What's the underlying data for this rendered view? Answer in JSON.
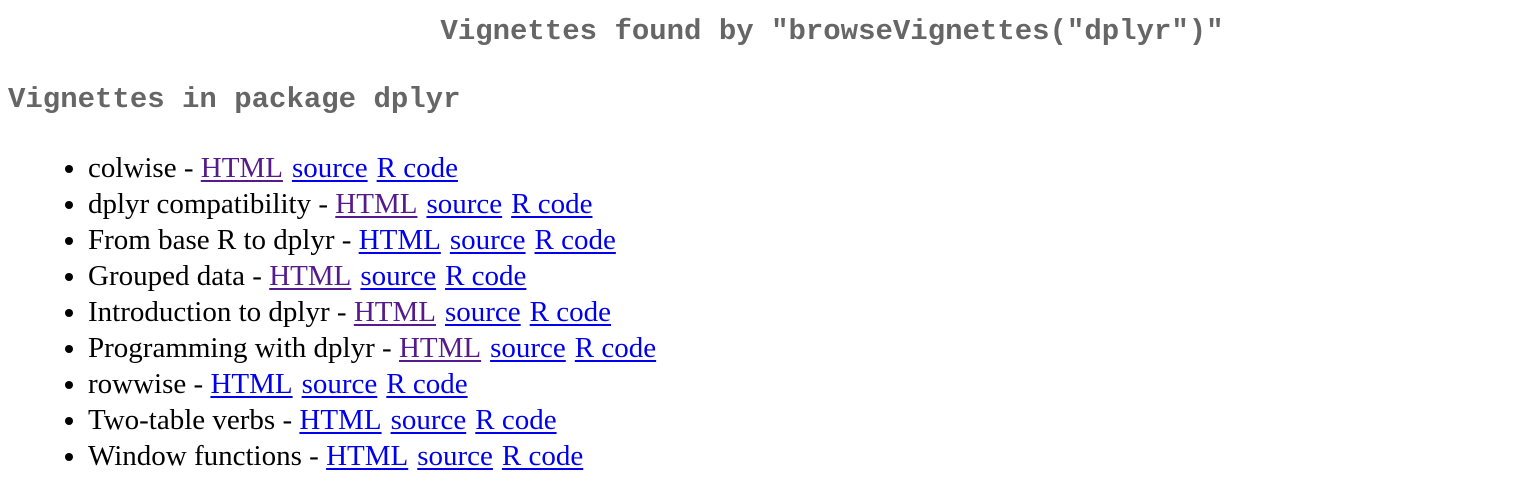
{
  "page": {
    "title": "Vignettes found by \"browseVignettes(\"dplyr\")\"",
    "section_heading": "Vignettes in package dplyr",
    "separator": " - "
  },
  "colors": {
    "heading": "#666666",
    "link": "#0000ee",
    "visited_link": "#551a8b"
  },
  "vignettes": [
    {
      "name": "colwise",
      "html": "HTML",
      "source": "source",
      "rcode": "R code",
      "html_visited": true
    },
    {
      "name": "dplyr compatibility",
      "html": "HTML",
      "source": "source",
      "rcode": "R code",
      "html_visited": true
    },
    {
      "name": "From base R to dplyr",
      "html": "HTML",
      "source": "source",
      "rcode": "R code",
      "html_visited": false
    },
    {
      "name": "Grouped data",
      "html": "HTML",
      "source": "source",
      "rcode": "R code",
      "html_visited": true
    },
    {
      "name": "Introduction to dplyr",
      "html": "HTML",
      "source": "source",
      "rcode": "R code",
      "html_visited": true
    },
    {
      "name": "Programming with dplyr",
      "html": "HTML",
      "source": "source",
      "rcode": "R code",
      "html_visited": true
    },
    {
      "name": "rowwise",
      "html": "HTML",
      "source": "source",
      "rcode": "R code",
      "html_visited": false
    },
    {
      "name": "Two-table verbs",
      "html": "HTML",
      "source": "source",
      "rcode": "R code",
      "html_visited": false
    },
    {
      "name": "Window functions",
      "html": "HTML",
      "source": "source",
      "rcode": "R code",
      "html_visited": false
    }
  ]
}
